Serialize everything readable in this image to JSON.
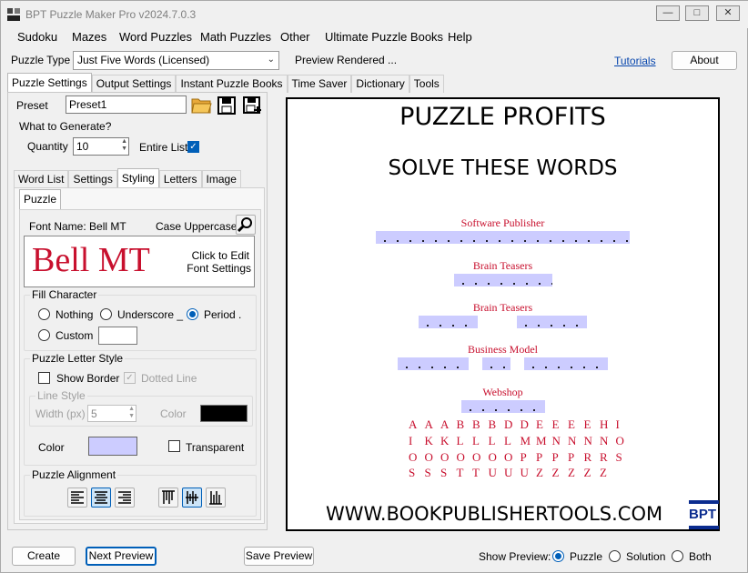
{
  "window": {
    "title": "BPT Puzzle Maker Pro v2024.7.0.3"
  },
  "menu": [
    "Sudoku",
    "Mazes",
    "Word Puzzles",
    "Math Puzzles",
    "Other",
    "Ultimate Puzzle Books",
    "Help"
  ],
  "toolbar": {
    "puzzle_type_label": "Puzzle Type",
    "puzzle_type_value": "Just Five Words (Licensed)",
    "status": "Preview Rendered ...",
    "tutorials": "Tutorials",
    "about": "About"
  },
  "main_tabs": [
    "Puzzle Settings",
    "Output Settings",
    "Instant Puzzle Books",
    "Time Saver",
    "Dictionary",
    "Tools"
  ],
  "preset": {
    "label": "Preset",
    "value": "Preset1"
  },
  "generate": {
    "group": "What to Generate?",
    "quantity_label": "Quantity",
    "quantity_value": "10",
    "entire_list": "Entire List"
  },
  "sub_tabs": [
    "Word List",
    "Settings",
    "Styling",
    "Letters",
    "Image"
  ],
  "inner_tab": "Puzzle",
  "font": {
    "name_label": "Font Name: Bell MT",
    "case_label": "Case Uppercase",
    "sample": "Bell MT",
    "edit_hint_1": "Click to Edit",
    "edit_hint_2": "Font Settings"
  },
  "fill": {
    "group": "Fill Character",
    "nothing": "Nothing",
    "underscore": "Underscore _",
    "period": "Period .",
    "custom": "Custom"
  },
  "letter_style": {
    "group": "Puzzle Letter Style",
    "show_border": "Show Border",
    "dotted_line": "Dotted Line",
    "line_style": "Line Style",
    "width_label": "Width (px)",
    "width_value": "5",
    "color_label": "Color",
    "color2_label": "Color",
    "transparent": "Transparent"
  },
  "alignment": {
    "group": "Puzzle Alignment"
  },
  "footer": {
    "create": "Create",
    "next_preview": "Next Preview",
    "save_preview": "Save Preview",
    "show_preview": "Show Preview:",
    "puzzle": "Puzzle",
    "solution": "Solution",
    "both": "Both"
  },
  "preview": {
    "title": "PUZZLE PROFITS",
    "subtitle": "SOLVE THESE WORDS",
    "clues": [
      "Software Publisher",
      "Brain Teasers",
      "Brain Teasers",
      "Business Model",
      "Webshop"
    ],
    "letters": [
      "A A A B B B D D E E E E H I",
      "I K K L L L L M M N N N N O",
      "O O O O O O O P P P P R R S",
      "S S S T T U U U Z Z Z Z Z"
    ],
    "website": "WWW.BOOKPUBLISHERTOOLS.COM",
    "logo": "BPT"
  },
  "colors": {
    "accent": "#005fb8",
    "word_red": "#c8102e",
    "blank_fill": "#ccccff",
    "line_color": "#000000"
  }
}
